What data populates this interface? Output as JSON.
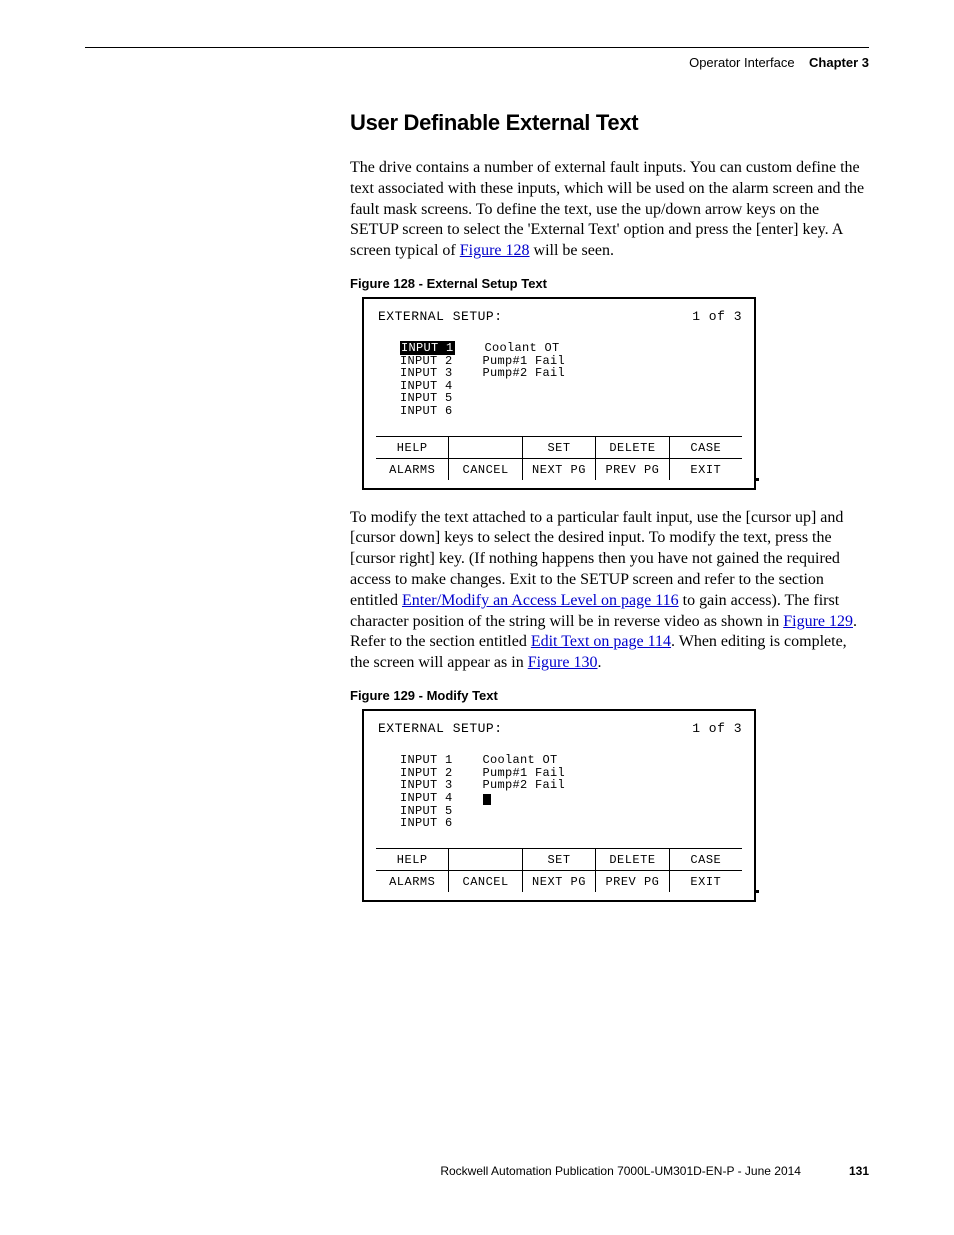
{
  "header": {
    "section": "Operator Interface",
    "chapter": "Chapter 3"
  },
  "title": "User Definable External Text",
  "para1_a": "The drive contains a number of external fault inputs. You can custom define the text associated with these inputs, which will be used on the alarm screen and the fault mask screens. To define the text, use the up/down arrow keys on the SETUP screen to select the 'External Text' option and press the [enter] key. A screen typical of ",
  "para1_link": "Figure 128",
  "para1_b": " will be seen.",
  "fig128_caption": "Figure 128 - External Setup Text",
  "terminal": {
    "title": "EXTERNAL SETUP:",
    "pager": "1 of  3",
    "inputs": [
      "INPUT 1",
      "INPUT 2",
      "INPUT 3",
      "INPUT 4",
      "INPUT 5",
      "INPUT 6"
    ],
    "values": [
      "Coolant OT",
      "Pump#1 Fail",
      "Pump#2 Fail",
      "",
      "",
      ""
    ],
    "keys_row1": [
      "HELP",
      "",
      "SET",
      "DELETE",
      "CASE"
    ],
    "keys_row2": [
      "ALARMS",
      "CANCEL",
      "NEXT PG",
      "PREV PG",
      "EXIT"
    ]
  },
  "para2_a": "To modify the text attached to a particular fault input, use the [cursor up] and [cursor down] keys to select the desired input.  To modify the text, press the [cursor right] key. (If nothing happens then you have not gained the required access to make changes. Exit to the SETUP screen and refer to the section entitled ",
  "para2_link1": "Enter/Modify an Access Level  on page 116",
  "para2_b": " to gain access). The first character position of the string will be in reverse video as shown in ",
  "para2_link2": "Figure 129",
  "para2_c": ". Refer to the section entitled ",
  "para2_link3": "Edit Text on page 114",
  "para2_d": ". When editing is complete, the screen will appear as in ",
  "para2_link4": "Figure 130",
  "para2_e": ".",
  "fig129_caption": "Figure 129 - Modify Text",
  "footer": {
    "pub": "Rockwell Automation Publication 7000L-UM301D-EN-P - June 2014",
    "page": "131"
  }
}
